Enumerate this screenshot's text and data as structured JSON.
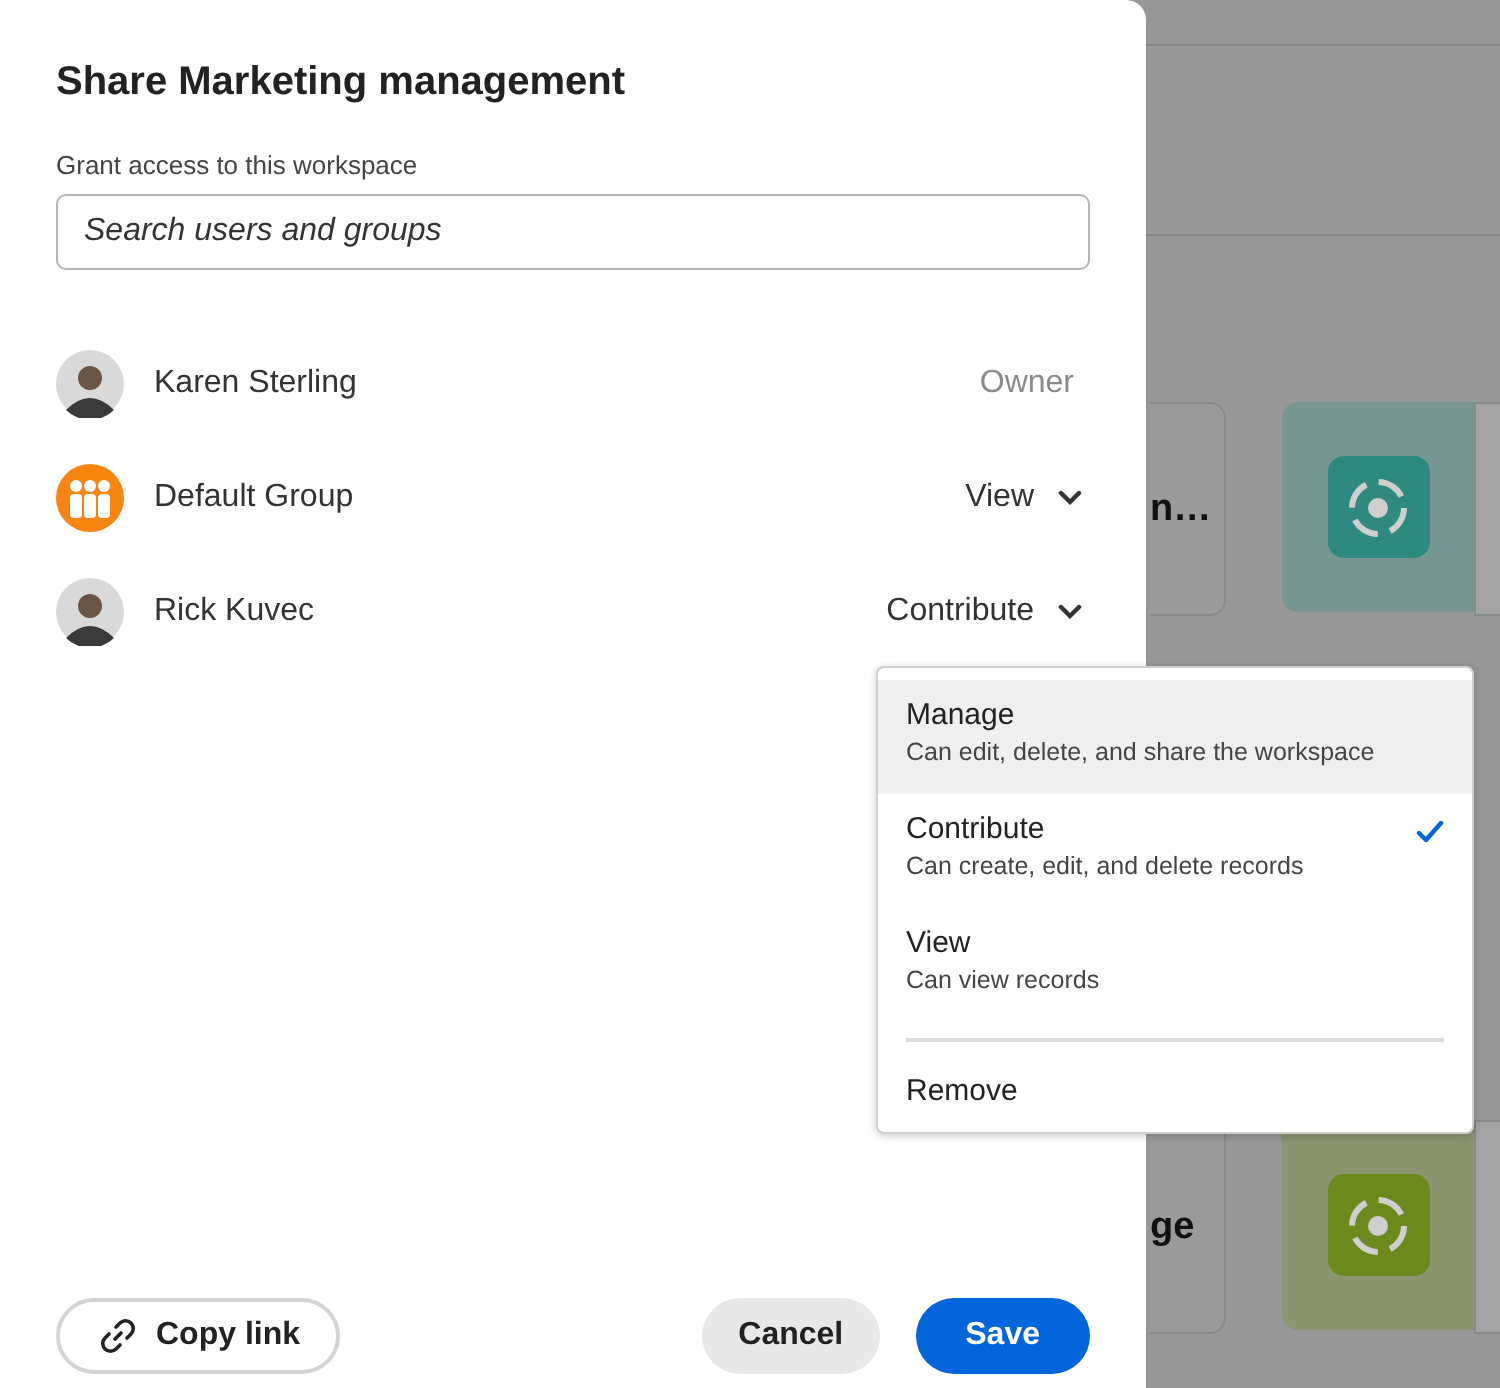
{
  "backdrop": {
    "cards": [
      {
        "kind": "text",
        "text": "n…"
      },
      {
        "kind": "tile",
        "color": "#2e8a80"
      },
      {
        "kind": "text",
        "text": "ge"
      },
      {
        "kind": "tile",
        "color": "#6b8a1e"
      }
    ]
  },
  "dialog": {
    "title": "Share Marketing management",
    "access_label": "Grant access to this workspace",
    "search": {
      "placeholder": "Search users and groups"
    },
    "members": [
      {
        "name": "Karen Sterling",
        "kind": "person",
        "role": "Owner",
        "editable": false
      },
      {
        "name": "Default Group",
        "kind": "group",
        "role": "View",
        "editable": true
      },
      {
        "name": "Rick Kuvec",
        "kind": "person",
        "role": "Contribute",
        "editable": true
      }
    ],
    "copy_link": "Copy link",
    "cancel": "Cancel",
    "save": "Save"
  },
  "role_menu": {
    "items": [
      {
        "label": "Manage",
        "description": "Can edit, delete, and share the workspace",
        "selected": false,
        "highlighted": true
      },
      {
        "label": "Contribute",
        "description": "Can create, edit, and delete records",
        "selected": true,
        "highlighted": false
      },
      {
        "label": "View",
        "description": "Can view records",
        "selected": false,
        "highlighted": false
      }
    ],
    "remove": "Remove"
  }
}
